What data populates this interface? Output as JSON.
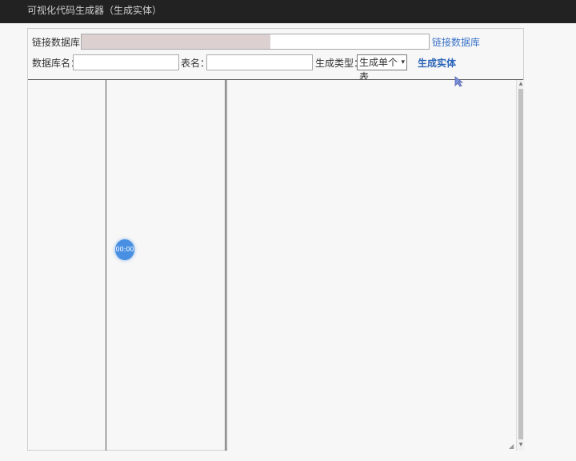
{
  "window": {
    "title": "可视化代码生成器（生成实体）"
  },
  "form": {
    "connection_label": "链接数据库：",
    "connection_value": "",
    "connect_link": "链接数据库",
    "dbname_label": "数据库名：",
    "dbname_value": "",
    "table_label": "表名：",
    "table_value": "",
    "gen_type_label": "生成类型：",
    "gen_type_selected": "生成单个表",
    "generate_link": "生成实体"
  },
  "overlay": {
    "timer_text": "00:00"
  },
  "colors": {
    "titlebar": "#222222",
    "link": "#3b73c8",
    "timer": "#4a90e2"
  }
}
